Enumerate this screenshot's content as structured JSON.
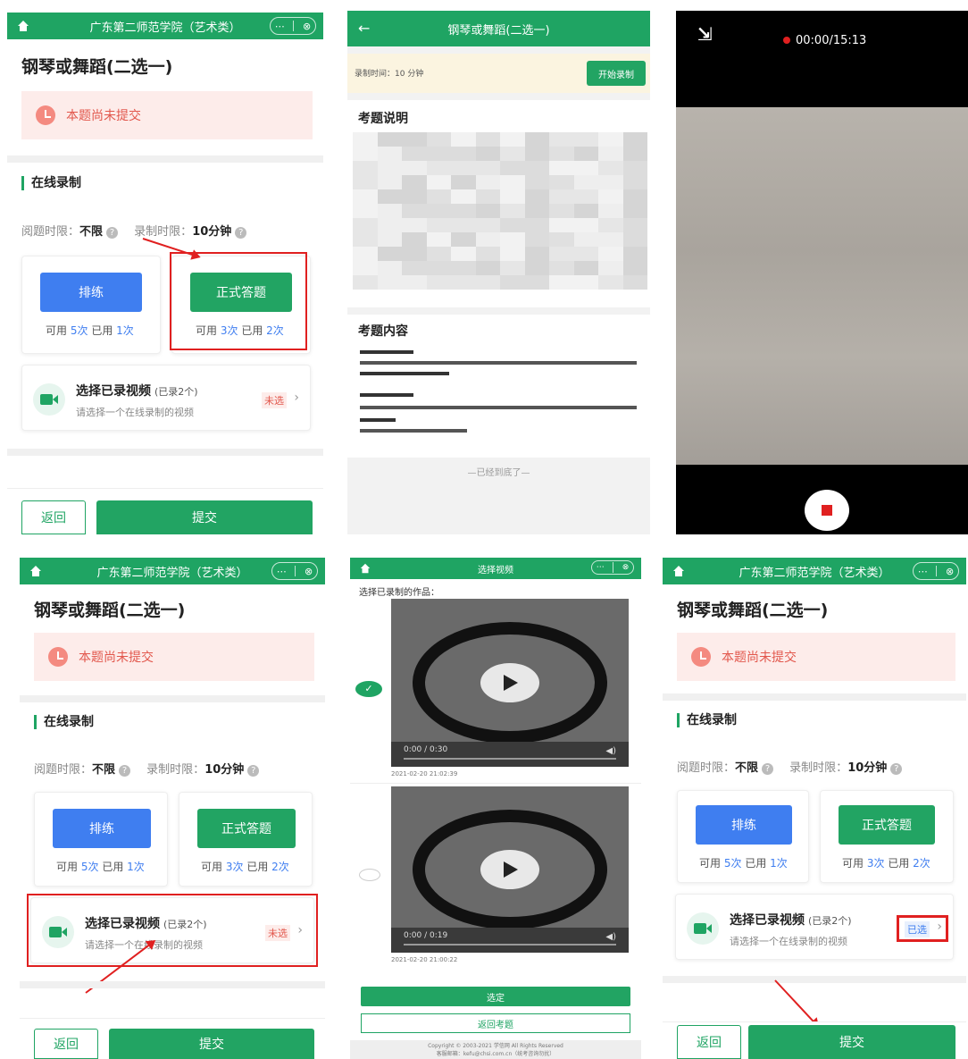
{
  "form": {
    "header_title": "广东第二师范学院（艺术类）",
    "question_title": "钢琴或舞蹈(二选一)",
    "notice": "本题尚未提交",
    "section": "在线录制",
    "read_limit_label": "阅题时限：",
    "read_limit_value": "不限",
    "rec_limit_label": "录制时限：",
    "rec_limit_value": "10分钟",
    "practice_label": "排练",
    "formal_label": "正式答题",
    "available": "可用",
    "used": "已用",
    "practice_avail": "5次",
    "practice_used": "1次",
    "formal_avail": "3次",
    "formal_used": "2次",
    "video_title": "选择已录视频",
    "video_count": "(已录2个)",
    "video_sub": "请选择一个在线录制的视频",
    "badge_unselected": "未选",
    "badge_selected": "已选",
    "back": "返回",
    "submit": "提交",
    "more_icon": "⋯",
    "close_icon": "⊗"
  },
  "exam_info": {
    "header_title": "钢琴或舞蹈(二选一)",
    "rec_time": "录制时间：10 分钟",
    "start_rec": "开始录制",
    "desc_title": "考题说明",
    "content_title": "考题内容",
    "end_text": "—已经到底了—"
  },
  "recorder": {
    "timer": "00:00/15:13"
  },
  "picker": {
    "header_title": "选择视频",
    "prompt": "选择已录制的作品：",
    "videos": [
      {
        "time": "0:00 / 0:30",
        "date": "2021-02-20 21:02:39"
      },
      {
        "time": "0:00 / 0:19",
        "date": "2021-02-20 21:00:22"
      }
    ],
    "confirm": "选定",
    "back_exam": "返回考题",
    "copyright": "Copyright © 2003-2021 学信网 All Rights Reserved",
    "contact": "客服邮箱：kefu@chsi.com.cn（统考咨询勿扰）"
  },
  "colors": {
    "brand_green": "#1fa463",
    "accent_blue": "#3f7ef0",
    "notice_red": "#e2574c",
    "highlight_red": "#e02020"
  }
}
